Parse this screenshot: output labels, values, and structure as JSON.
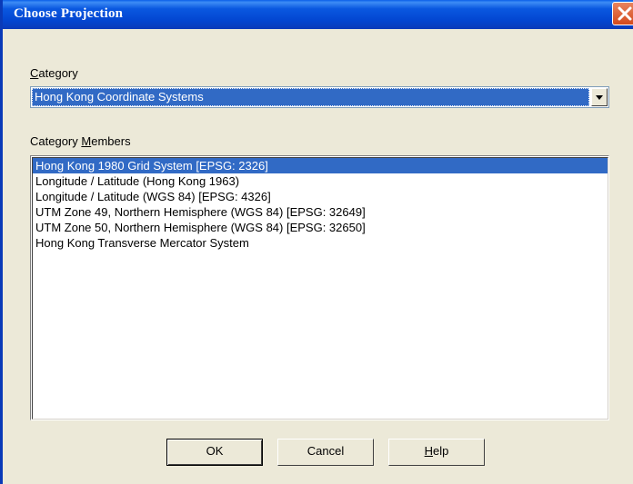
{
  "window": {
    "title": "Choose Projection",
    "close_icon": "close-icon"
  },
  "category": {
    "label_prefix": "",
    "label_underline": "C",
    "label_rest": "ategory",
    "selected_value": "Hong Kong Coordinate Systems"
  },
  "members": {
    "label_prefix": "Category ",
    "label_underline": "M",
    "label_rest": "embers",
    "items": [
      {
        "label": "Hong Kong 1980 Grid System [EPSG: 2326]",
        "selected": true
      },
      {
        "label": "Longitude / Latitude (Hong Kong 1963)",
        "selected": false
      },
      {
        "label": "Longitude / Latitude (WGS 84) [EPSG: 4326]",
        "selected": false
      },
      {
        "label": "UTM Zone 49, Northern Hemisphere (WGS 84) [EPSG: 32649]",
        "selected": false
      },
      {
        "label": "UTM Zone 50, Northern Hemisphere (WGS 84) [EPSG: 32650]",
        "selected": false
      },
      {
        "label": "Hong Kong Transverse Mercator System",
        "selected": false
      }
    ]
  },
  "buttons": {
    "ok": "OK",
    "cancel": "Cancel",
    "help_underline": "H",
    "help_rest": "elp"
  },
  "colors": {
    "title_bar": "#0a58e0",
    "selection": "#316ac5",
    "dialog_bg": "#ece9d8"
  }
}
